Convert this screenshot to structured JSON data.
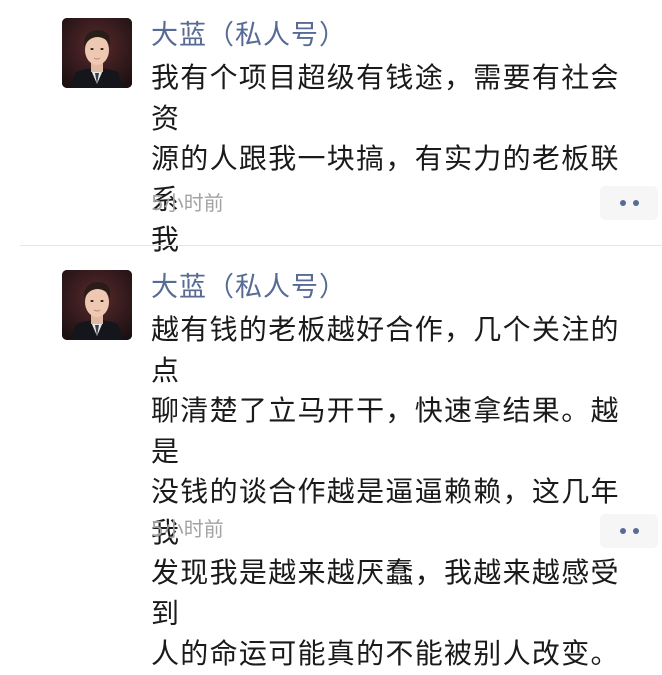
{
  "posts": [
    {
      "author": "大蓝（私人号）",
      "content": "我有个项目超级有钱途，需要有社会资\n源的人跟我一块搞，有实力的老板联系\n我",
      "time": "5小时前",
      "action_icon": "more-dots-icon"
    },
    {
      "author": "大蓝（私人号）",
      "content": "越有钱的老板越好合作，几个关注的点\n聊清楚了立马开干，快速拿结果。越是\n没钱的谈合作越是逼逼赖赖，这几年我\n发现我是越来越厌蠢，我越来越感受到\n人的命运可能真的不能被别人改变。",
      "time": "5小时前",
      "action_icon": "more-dots-icon"
    }
  ],
  "colors": {
    "author": "#576b95",
    "text": "#1a1a1a",
    "time": "#a3a3a3",
    "action_bg": "#f6f6f6"
  }
}
